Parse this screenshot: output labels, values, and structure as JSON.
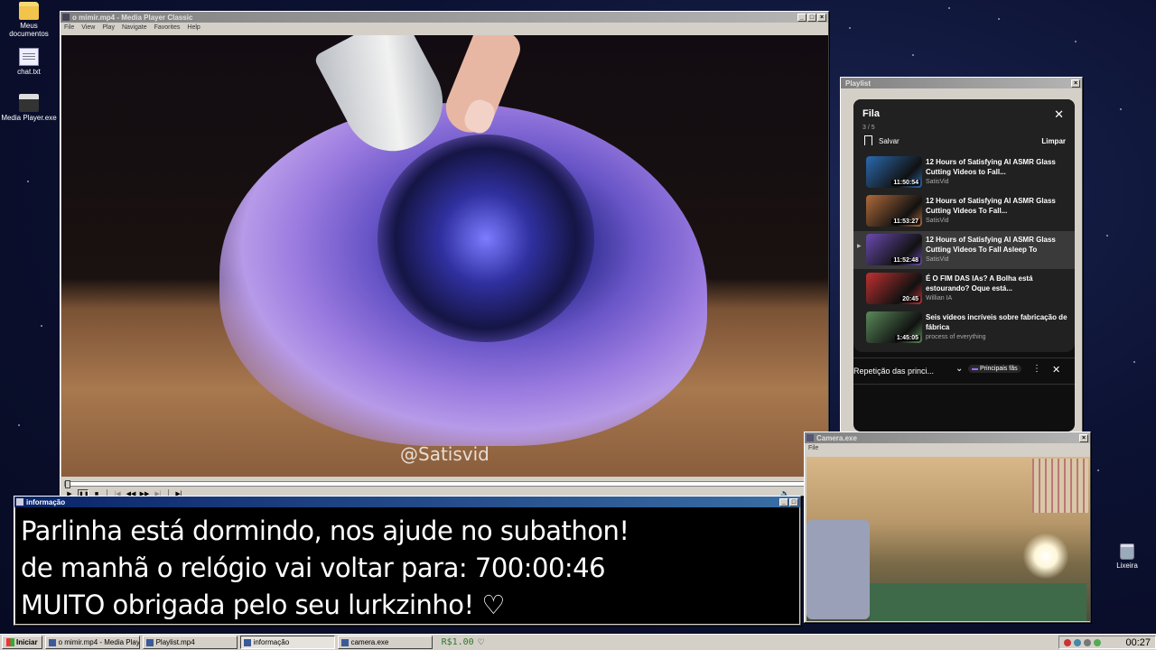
{
  "desktop": {
    "icons": [
      {
        "label": "Meus documentos"
      },
      {
        "label": "chat.txt"
      },
      {
        "label": "Media Player.exe"
      },
      {
        "label": "Lixeira"
      }
    ]
  },
  "mpc": {
    "title": "o mimir.mp4 - Media Player Classic",
    "menu": [
      "File",
      "View",
      "Play",
      "Navigate",
      "Favorites",
      "Help"
    ],
    "watermark": "@Satisvid",
    "progress": 0.0
  },
  "playlist_window": {
    "title": "Playlist",
    "queue": {
      "title": "Fila",
      "count": "3 / 5",
      "save_label": "Salvar",
      "clear_label": "Limpar",
      "items": [
        {
          "title": "12 Hours of Satisfying AI ASMR Glass Cutting Videos to Fall...",
          "channel": "SatisVid",
          "duration": "11:50:54",
          "current": false,
          "thumb_color": "#2a6ab0"
        },
        {
          "title": "12 Hours of Satisfying AI ASMR Glass Cutting Videos To Fall...",
          "channel": "SatisVid",
          "duration": "11:53:27",
          "current": false,
          "thumb_color": "#b06a3a"
        },
        {
          "title": "12 Hours of Satisfying AI ASMR Glass Cutting Videos To Fall Asleep To",
          "channel": "SatisVid",
          "duration": "11:52:48",
          "current": true,
          "thumb_color": "#6a4ab0"
        },
        {
          "title": "É O FIM DAS IAs? A Bolha está estourando? Oque está...",
          "channel": "Willian IA",
          "duration": "20:45",
          "current": false,
          "thumb_color": "#c03030"
        },
        {
          "title": "Seis vídeos incríveis sobre fabricação de fábrica",
          "channel": "process of everything",
          "duration": "1:45:05",
          "current": false,
          "thumb_color": "#5a8a5a"
        }
      ]
    },
    "bar": {
      "loop_label": "Repetição das princi...",
      "chip_label": "Principais fãs"
    }
  },
  "camera": {
    "title": "Camera.exe",
    "menu": [
      "File"
    ]
  },
  "info": {
    "title": "informação",
    "lines": [
      "Parlinha está dormindo, nos ajude no subathon!",
      "de manhã o relógio vai voltar para:  700:00:46",
      "MUITO obrigada pelo seu lurkzinho! ♡"
    ]
  },
  "taskbar": {
    "start_label": "Iniciar",
    "tasks": [
      {
        "label": "o mimir.mp4 - Media Playe...",
        "active": false
      },
      {
        "label": "Playlist.mp4",
        "active": false
      },
      {
        "label": "informação",
        "active": true
      },
      {
        "label": "camera.exe",
        "active": false
      }
    ],
    "balance": "R$1.00",
    "balance_heart": "♡",
    "clock": "00:27"
  }
}
